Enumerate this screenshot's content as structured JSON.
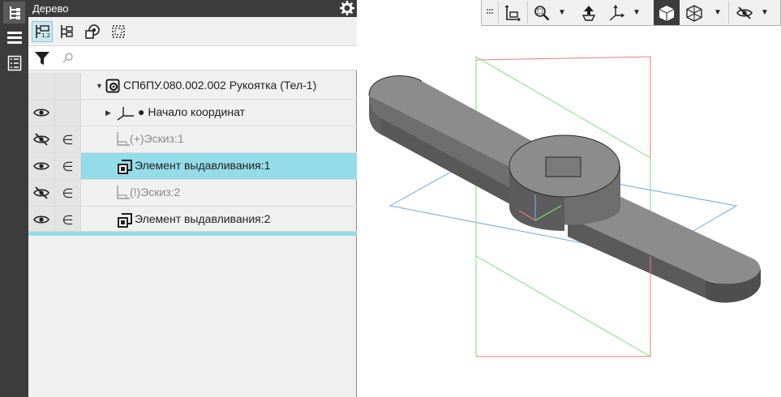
{
  "panel": {
    "title": "Дерево",
    "search_placeholder": ""
  },
  "tree": {
    "root_label": "СП6ПУ.080.002.002 Рукоятка (Тел-1)",
    "items": [
      {
        "label": "Начало координат",
        "visible": true,
        "has_belongs": false
      },
      {
        "label": "Эскиз:1",
        "visible": false,
        "has_belongs": true,
        "dim": true
      },
      {
        "label": "Элемент выдавливания:1",
        "visible": true,
        "has_belongs": true,
        "selected": true
      },
      {
        "label": "Эскиз:2",
        "visible": false,
        "has_belongs": true,
        "dim": true
      },
      {
        "label": "Элемент выдавливания:2",
        "visible": true,
        "has_belongs": true
      }
    ],
    "sketch1_prefix": "(+)",
    "sketch2_prefix": "(!)"
  },
  "colors": {
    "selection": "#94dce8",
    "dark_bar": "#3c3c3c",
    "plane_red": "#f07a7a",
    "plane_green": "#7ee07e",
    "plane_blue": "#6ea6e8",
    "model_gray": "#8c8c8c"
  },
  "icons": [
    "tree-structure-icon",
    "menu-icon",
    "properties-list-icon",
    "gear-icon",
    "filter-icon",
    "search-icon",
    "eye-icon",
    "eye-hidden-icon",
    "belongs-icon",
    "part-icon",
    "origin-icon",
    "sketch-icon",
    "extrude-icon",
    "view-orientation-icon",
    "zoom-icon",
    "pan-icon",
    "axes-icon",
    "shaded-icon",
    "wireframe-icon",
    "hide-icon"
  ]
}
